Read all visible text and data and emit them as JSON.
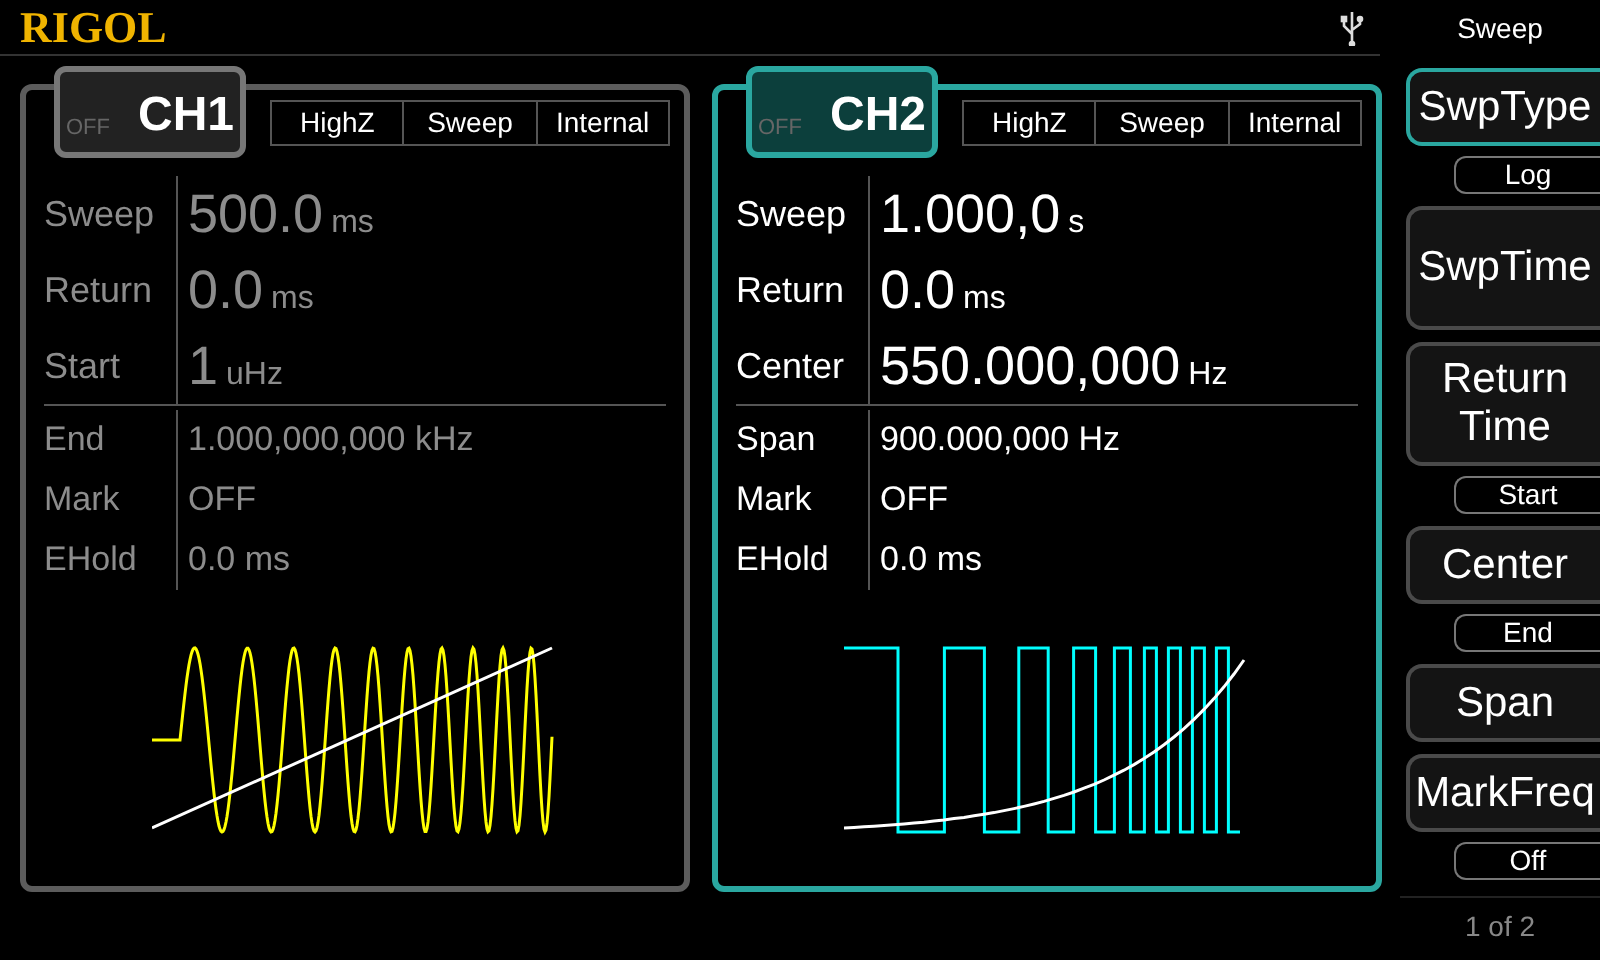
{
  "header": {
    "logo": "RIGOL"
  },
  "channels": [
    {
      "name": "CH1",
      "output": "OFF",
      "selected": false,
      "tags": [
        "HighZ",
        "Sweep",
        "Internal"
      ],
      "kind": "sine",
      "color": "#ffff00",
      "primary_params": [
        {
          "label": "Sweep",
          "value": "500.0",
          "unit": "ms"
        },
        {
          "label": "Return",
          "value": "0.0",
          "unit": "ms"
        },
        {
          "label": "Start",
          "value": "1",
          "unit": "uHz"
        }
      ],
      "secondary_params": [
        {
          "label": "End",
          "value": "1.000,000,000 kHz"
        },
        {
          "label": "Mark",
          "value": "OFF"
        },
        {
          "label": "EHold",
          "value": "0.0 ms"
        }
      ]
    },
    {
      "name": "CH2",
      "output": "OFF",
      "selected": true,
      "tags": [
        "HighZ",
        "Sweep",
        "Internal"
      ],
      "kind": "square",
      "color": "#00ffff",
      "primary_params": [
        {
          "label": "Sweep",
          "value": "1.000,0",
          "unit": "s"
        },
        {
          "label": "Return",
          "value": "0.0",
          "unit": "ms"
        },
        {
          "label": "Center",
          "value": "550.000,000",
          "unit": "Hz"
        }
      ],
      "secondary_params": [
        {
          "label": "Span",
          "value": "900.000,000 Hz"
        },
        {
          "label": "Mark",
          "value": "OFF"
        },
        {
          "label": "EHold",
          "value": "0.0 ms"
        }
      ]
    }
  ],
  "menu": {
    "title": "Sweep",
    "items": [
      {
        "kind": "key",
        "label": "SwpType",
        "selected": true
      },
      {
        "kind": "value",
        "label": "Log"
      },
      {
        "kind": "tall_key",
        "label": "SwpTime",
        "selected": false
      },
      {
        "kind": "tall_key",
        "label": "Return Time",
        "selected": false
      },
      {
        "kind": "value",
        "label": "Start"
      },
      {
        "kind": "key",
        "label": "Center",
        "selected": false
      },
      {
        "kind": "value",
        "label": "End"
      },
      {
        "kind": "key",
        "label": "Span",
        "selected": false
      },
      {
        "kind": "key",
        "label": "MarkFreq",
        "selected": false
      },
      {
        "kind": "value",
        "label": "Off"
      }
    ],
    "page": "1 of 2"
  }
}
